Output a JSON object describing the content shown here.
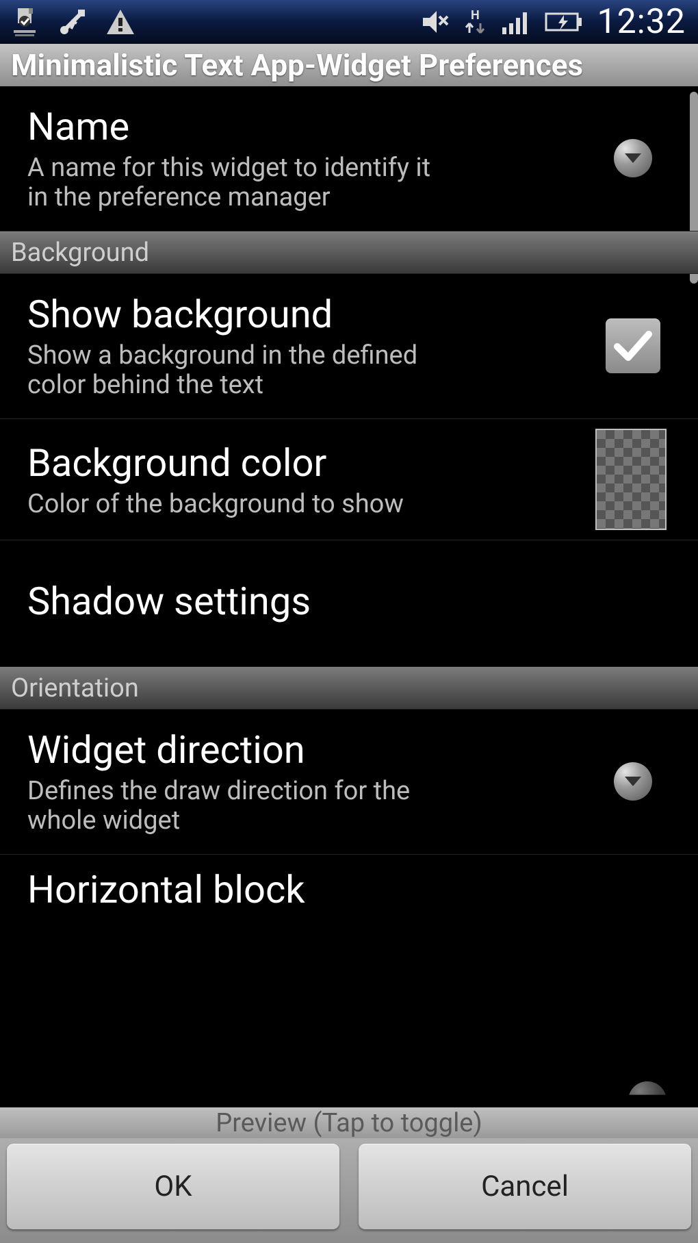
{
  "status_bar": {
    "clock": "12:32"
  },
  "title": "Minimalistic Text App-Widget Preferences",
  "prefs": {
    "name": {
      "title": "Name",
      "sub": "A name for this widget to identify it in the preference manager"
    },
    "cat_background": "Background",
    "show_bg": {
      "title": "Show background",
      "sub": "Show a background in the defined color behind the text",
      "checked": true
    },
    "bg_color": {
      "title": "Background color",
      "sub": "Color of the background to show"
    },
    "shadow": {
      "title": "Shadow settings"
    },
    "cat_orientation": "Orientation",
    "direction": {
      "title": "Widget direction",
      "sub": "Defines the draw direction for the whole widget"
    },
    "horiz_block": {
      "title": "Horizontal block"
    }
  },
  "preview_bar": "Preview (Tap to toggle)",
  "buttons": {
    "ok": "OK",
    "cancel": "Cancel"
  }
}
